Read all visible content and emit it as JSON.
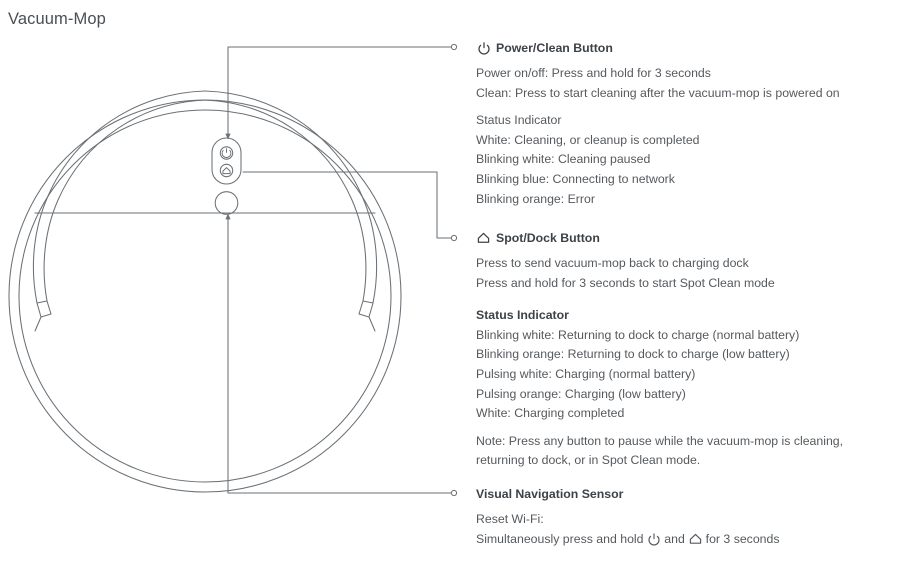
{
  "title": "Vacuum-Mop",
  "colors": {
    "line": "#6b7176",
    "title_text": "#4a4f54",
    "heading_text": "#3c4247",
    "body_text": "#55595d",
    "background": "#ffffff"
  },
  "diagram": {
    "name": "robot-vacuum-top-view",
    "parts": {
      "outer_bumper": "outer-bumper-arc",
      "body": "main-body-circle",
      "inner_ring": "inner-body-circle",
      "button_pod": "button-pod",
      "power_button": "power-clean-button",
      "dock_button": "spot-dock-button",
      "sensor": "visual-navigation-sensor"
    }
  },
  "icons": {
    "power": "power-icon",
    "home": "home-icon"
  },
  "callouts": [
    {
      "id": "power-clean",
      "heading": "Power/Clean Button",
      "heading_icon": "power-icon",
      "lines": [
        {
          "text": "Power on/off: Press and hold for 3 seconds",
          "bold": false
        },
        {
          "text": "Clean: Press to start cleaning after the vacuum-mop is powered on",
          "bold": false
        }
      ],
      "status_label": "Status Indicator",
      "status_label_bold": false,
      "status_lines": [
        "White:  Cleaning, or cleanup is completed",
        "Blinking white:  Cleaning paused",
        "Blinking blue:  Connecting to network",
        "Blinking orange:  Error"
      ]
    },
    {
      "id": "spot-dock",
      "heading": "Spot/Dock Button",
      "heading_icon": "home-icon",
      "lines": [
        {
          "text": "Press to send vacuum-mop back to charging dock",
          "bold": false
        },
        {
          "text": "Press and hold for 3 seconds to start Spot Clean mode",
          "bold": false
        }
      ],
      "status_label": "Status Indicator",
      "status_label_bold": true,
      "status_lines": [
        "Blinking white:  Returning to dock to charge (normal battery)",
        "Blinking orange:  Returning to dock to charge (low battery)",
        "Pulsing white:  Charging (normal battery)",
        "Pulsing orange:  Charging (low battery)",
        "White:  Charging completed"
      ],
      "note": "Note: Press any button to pause while the vacuum-mop is cleaning, returning to dock, or in Spot Clean mode."
    },
    {
      "id": "visual-navigation-sensor",
      "heading": "Visual Navigation Sensor",
      "heading_icon": null,
      "reset_label": "Reset Wi-Fi:",
      "reset_prefix": "Simultaneously press and hold ",
      "reset_mid": " and ",
      "reset_suffix": " for 3 seconds"
    }
  ]
}
